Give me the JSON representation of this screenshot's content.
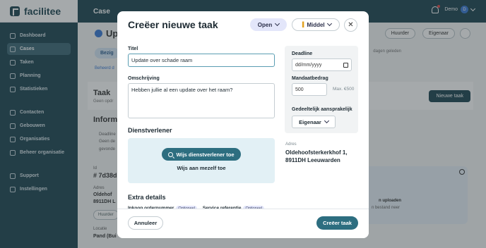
{
  "app": {
    "name": "facilitee"
  },
  "topbar": {
    "title": "Case",
    "user_name": "Demo",
    "user_initial": "D"
  },
  "sidebar": {
    "items": [
      {
        "label": "Dashboard",
        "icon": "home-icon"
      },
      {
        "label": "Cases",
        "icon": "document-icon",
        "active": true
      },
      {
        "label": "Taken",
        "icon": "wrench-icon"
      },
      {
        "label": "Planning",
        "icon": "calendar-icon"
      },
      {
        "label": "Statistieken",
        "icon": "chart-icon"
      },
      {
        "label": "Contacten",
        "icon": "contacts-icon"
      },
      {
        "label": "Gebouwen",
        "icon": "building-icon"
      },
      {
        "label": "Organisaties",
        "icon": "organisation-icon"
      },
      {
        "label": "Beheer organisatie",
        "icon": "settings-org-icon"
      },
      {
        "label": "Support",
        "icon": "support-icon"
      },
      {
        "label": "Instellingen",
        "icon": "gear-icon"
      }
    ]
  },
  "background": {
    "case_title": "Up",
    "chip": "Bezig",
    "beheerd": "Beheerd d",
    "since": "dagen geleden",
    "hurder_btn": "Huurder",
    "eigenaar_btn": "Eigenaar",
    "taak_title": "Taak",
    "taak_sub": "Geen opdr",
    "nieuwe_taak": "Nieuwe taak",
    "info_title": "Inform",
    "deadline_lbl": "Deadline",
    "geen_text": "Geen de",
    "gevonden_text": "gevonde",
    "id_lbl": "Id",
    "id_val": "# 7d38d",
    "adres_lbl": "Adres",
    "adres_line1": "Oldehof",
    "adres_line2": "8911DH L",
    "hurd_chip": "Huurder",
    "locatie_lbl": "Locatie",
    "locatie_val": "Pand (Bui",
    "upload_title": "n uploaden",
    "upload_sub": "n bestand neer"
  },
  "modal": {
    "title": "Creëer nieuwe taak",
    "status": "Open",
    "priority": "Middel",
    "titel_label": "Titel",
    "titel_value": "Update over schade raam",
    "omschrijving_label": "Omschrijving",
    "omschrijving_value": "Hebben jullie al een update over het raam?",
    "deadline_label": "Deadline",
    "deadline_placeholder": "dd/mm/yyyy",
    "mandaat_label": "Mandaatbedrag",
    "mandaat_value": "500",
    "mandaat_max": "Max. €500",
    "aansprakelijk_label": "Gedeeltelijk aansprakelijk",
    "aansprakelijk_value": "Eigenaar",
    "dienstverlener_title": "Dienstverlener",
    "search_dienstverlener": "Wijs dienstverlener toe",
    "self_assign": "Wijs aan mezelf toe",
    "adres_label": "Adres",
    "adres_line1": "Oldehoofsterkerkhof 1,",
    "adres_line2": "8911DH Leeuwarden",
    "extra_title": "Extra details",
    "inkoop_label": "Inkoop ordernummer",
    "service_label": "Service referentie",
    "optional_badge": "Optioneel",
    "cancel": "Annuleer",
    "create": "Creëer taak"
  }
}
